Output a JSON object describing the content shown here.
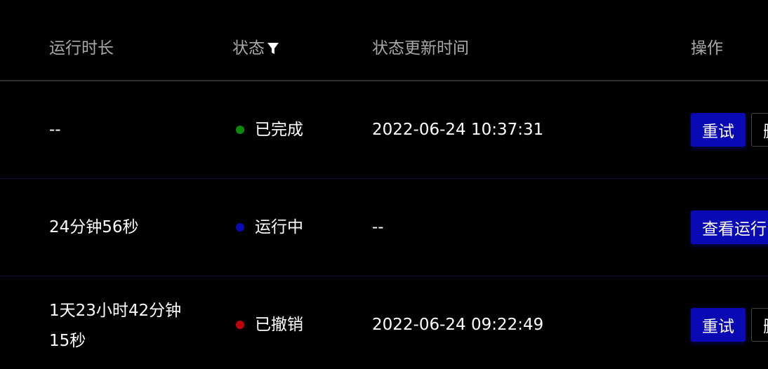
{
  "table": {
    "columns": {
      "duration": "运行时长",
      "status": "状态",
      "updated": "状态更新时间",
      "actions": "操作"
    },
    "filter_icon": "filter-icon",
    "rows": [
      {
        "duration": "--",
        "status": "已完成",
        "status_color": "#0a8a0a",
        "updated": "2022-06-24 10:37:31",
        "primary_action": "重试",
        "secondary_action": "删"
      },
      {
        "duration": "24分钟56秒",
        "status": "运行中",
        "status_color": "#0a0ab4",
        "updated": "--",
        "primary_action": "查看运行"
      },
      {
        "duration": "1天23小时42分钟15秒",
        "status": "已撤销",
        "status_color": "#c0000a",
        "updated": "2022-06-24 09:22:49",
        "primary_action": "重试",
        "secondary_action": "删"
      }
    ]
  },
  "colors": {
    "background": "#000000",
    "header_text": "#a8a8a8",
    "primary_button": "#0a0ab4",
    "row_divider": "#0a0a3a"
  }
}
